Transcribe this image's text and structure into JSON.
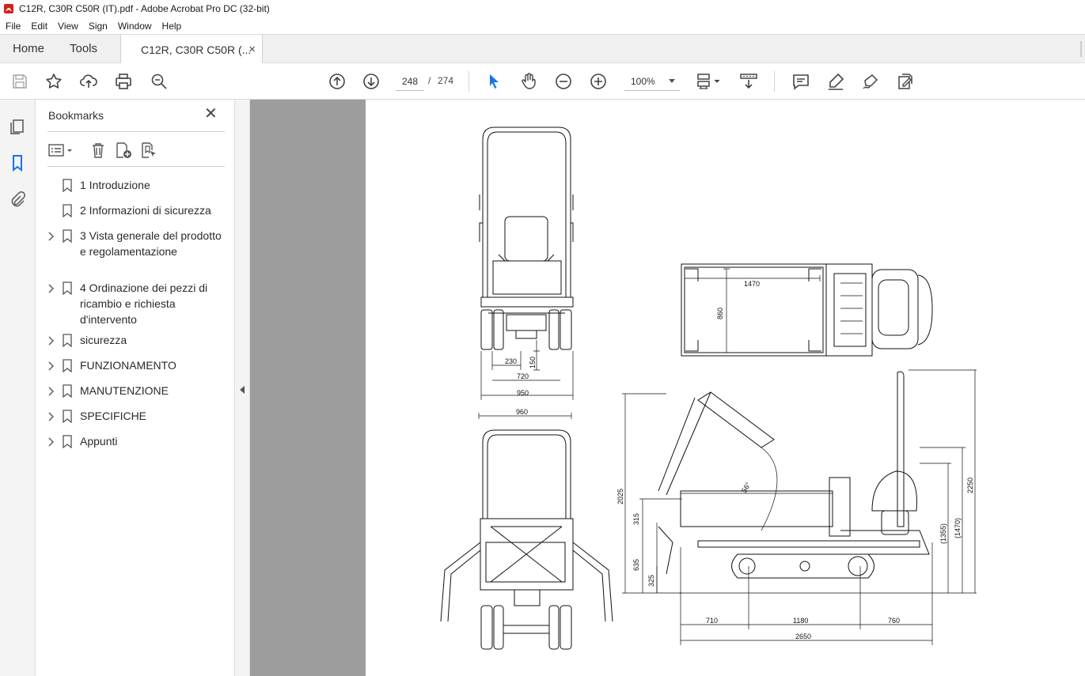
{
  "window": {
    "title": "C12R, C30R C50R (IT).pdf - Adobe Acrobat Pro DC (32-bit)"
  },
  "menu": [
    "File",
    "Edit",
    "View",
    "Sign",
    "Window",
    "Help"
  ],
  "tabs": {
    "home": "Home",
    "tools": "Tools",
    "document": "C12R, C30R C50R (...",
    "close": "×"
  },
  "toolbar": {
    "page_current": "248",
    "page_separator": "/",
    "page_total": "274",
    "zoom": "100%",
    "icons": [
      "save-icon",
      "star-icon",
      "upload-icon",
      "print-icon",
      "search-zoom-icon",
      "page-up-icon",
      "page-down-icon",
      "select-arrow-icon",
      "hand-icon",
      "zoom-out-icon",
      "zoom-in-icon",
      "page-layout-icon",
      "scroll-mode-icon",
      "comment-icon",
      "highlight-icon",
      "sign-icon",
      "fill-sign-icon"
    ]
  },
  "bookmarks": {
    "title": "Bookmarks",
    "close": "✕",
    "items": [
      {
        "label": "1 Introduzione",
        "expandable": false
      },
      {
        "label": "2 Informazioni di sicurezza",
        "expandable": false
      },
      {
        "label": "3 Vista generale del prodotto e regolamentazione",
        "expandable": true
      },
      {
        "label": "4 Ordinazione dei pezzi di ricambio e richiesta d'intervento",
        "expandable": true
      },
      {
        "label": "sicurezza",
        "expandable": true
      },
      {
        "label": "FUNZIONAMENTO",
        "expandable": true
      },
      {
        "label": "MANUTENZIONE",
        "expandable": true
      },
      {
        "label": "SPECIFICHE",
        "expandable": true
      },
      {
        "label": "Appunti",
        "expandable": true
      }
    ]
  },
  "drawing": {
    "dims": {
      "d230": "230",
      "d150": "150",
      "d720": "720",
      "d950": "950",
      "d960": "960",
      "d1470": "1470",
      "d860": "860",
      "d2025": "2025",
      "d315": "315",
      "d635": "635",
      "d325": "325",
      "d1355": "(1355)",
      "d1470p": "(1470)",
      "d2250": "2250",
      "d710": "710",
      "d1180": "1180",
      "d760": "760",
      "d2650": "2650",
      "angle": "56°"
    }
  },
  "colors": {
    "acrobat_red": "#d4201b",
    "accent_blue": "#1473e6",
    "gutter_gray": "#9d9d9d"
  }
}
